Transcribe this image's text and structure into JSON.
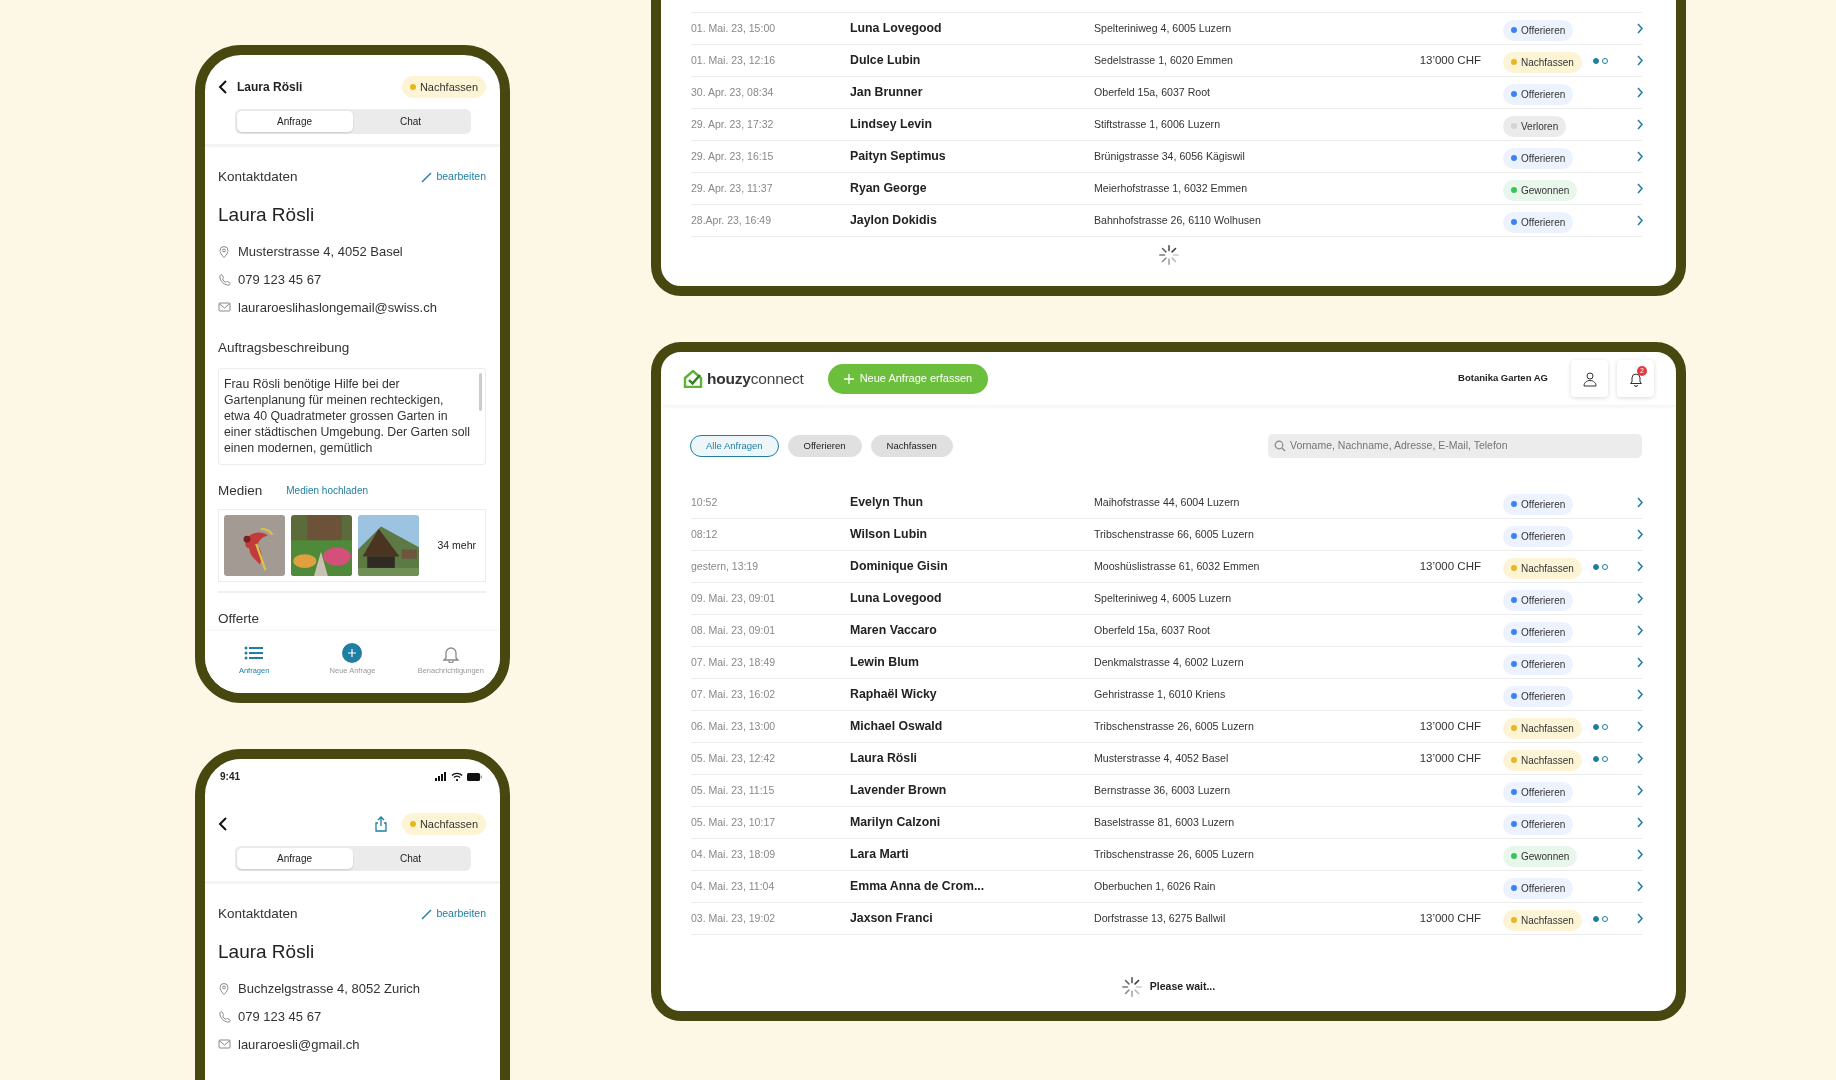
{
  "phone_detail": {
    "title": "Laura Rösli",
    "status": {
      "kind": "followup",
      "label": "Nachfassen",
      "color": "#e6b81e"
    },
    "tabs": [
      {
        "label": "Anfrage",
        "selected": true
      },
      {
        "label": "Chat",
        "selected": false
      }
    ],
    "contact": {
      "heading": "Kontaktdaten",
      "edit_link": "bearbeiten",
      "name": "Laura Rösli",
      "address": "Musterstrasse 4, 4052 Basel",
      "phone": "079 123 45 67",
      "email": "lauraroeslihaslongemail@swiss.ch"
    },
    "description": {
      "heading": "Auftragsbeschreibung",
      "text": "Frau Rösli benötige Hilfe bei der Gartenplanung für meinen rechteckigen, etwa 40 Quadratmeter grossen Garten in einer städtischen Umgebung. Der Garten soll einen modernen, gemütlich"
    },
    "media": {
      "heading": "Medien",
      "upload_link": "Medien hochladen",
      "more": "34 mehr"
    },
    "next_section": "Offerte",
    "bottom_nav": [
      {
        "kind": "list",
        "label": "Anfragen",
        "selected": true
      },
      {
        "kind": "add",
        "label": "Neue Anfrage",
        "selected": false
      },
      {
        "kind": "bell",
        "label": "Benachrichtigungen",
        "selected": false
      }
    ]
  },
  "phone_detail_2": {
    "status_bar": {
      "time": "9:41"
    },
    "status": {
      "kind": "followup",
      "label": "Nachfassen",
      "color": "#e6b81e"
    },
    "tabs": [
      {
        "label": "Anfrage",
        "selected": true
      },
      {
        "label": "Chat",
        "selected": false
      }
    ],
    "contact": {
      "heading": "Kontaktdaten",
      "edit_link": "bearbeiten",
      "name": "Laura Rösli",
      "address": "Buchzelgstrasse 4, 8052 Zurich",
      "phone": "079 123 45 67",
      "email": "lauraroesli@gmail.ch"
    }
  },
  "tablet_list_scrolled": {
    "rows": [
      {
        "time": "01. Mai. 23, 15:00",
        "name": "Luna Lovegood",
        "address": "Spelteriniweg 4, 6005 Luzern",
        "status": {
          "kind": "offer",
          "label": "Offerieren",
          "color": "#3b82f6"
        }
      },
      {
        "time": "01. Mai. 23, 12:16",
        "name": "Dulce Lubin",
        "address": "Sedelstrasse 1, 6020 Emmen",
        "price": "13’000 CHF",
        "status": {
          "kind": "followup",
          "label": "Nachfassen",
          "color": "#e6b81e"
        },
        "steps": [
          {
            "done": true
          },
          {
            "done": false
          }
        ]
      },
      {
        "time": "30. Apr. 23, 08:34",
        "name": "Jan Brunner",
        "address": "Oberfeld 15a, 6037 Root",
        "status": {
          "kind": "offer",
          "label": "Offerieren",
          "color": "#3b82f6"
        }
      },
      {
        "time": "29. Apr. 23, 17:32",
        "name": "Lindsey Levin",
        "address": "Stiftstrasse 1, 6006 Luzern",
        "status": {
          "kind": "lost",
          "label": "Verloren",
          "color": "#d4d4d4"
        }
      },
      {
        "time": "29. Apr. 23, 16:15",
        "name": "Paityn Septimus",
        "address": "Brünigstrasse 34, 6056 Kägiswil",
        "status": {
          "kind": "offer",
          "label": "Offerieren",
          "color": "#3b82f6"
        }
      },
      {
        "time": "29. Apr. 23, 11:37",
        "name": "Ryan George",
        "address": "Meierhofstrasse 1, 6032 Emmen",
        "status": {
          "kind": "won",
          "label": "Gewonnen",
          "color": "#34c759"
        }
      },
      {
        "time": "28.Apr. 23, 16:49",
        "name": "Jaylon Dokidis",
        "address": "Bahnhofstrasse 26, 6110 Wolhusen",
        "status": {
          "kind": "offer",
          "label": "Offerieren",
          "color": "#3b82f6"
        }
      }
    ]
  },
  "tablet_list": {
    "brand": "**houzy**connect",
    "new_button": "Neue Anfrage erfassen",
    "company": "Botanika Garten AG",
    "notification_count": "2",
    "filters": [
      {
        "label": "Alle Anfragen",
        "selected": true
      },
      {
        "label": "Offerieren",
        "selected": false
      },
      {
        "label": "Nachfassen",
        "selected": false
      }
    ],
    "search": {
      "placeholder": "Vorname, Nachname, Adresse, E-Mail, Telefon"
    },
    "rows": [
      {
        "time": "10:52",
        "name": "Evelyn Thun",
        "address": "Maihofstrasse 44, 6004 Luzern",
        "status": {
          "kind": "offer",
          "label": "Offerieren",
          "color": "#3b82f6"
        }
      },
      {
        "time": "08:12",
        "name": "Wilson Lubin",
        "address": "Tribschenstrasse 66, 6005 Luzern",
        "status": {
          "kind": "offer",
          "label": "Offerieren",
          "color": "#3b82f6"
        }
      },
      {
        "time": "gestern, 13:19",
        "name": "Dominique Gisin",
        "address": "Mooshüslistrasse 61, 6032 Emmen",
        "price": "13’000 CHF",
        "status": {
          "kind": "followup",
          "label": "Nachfassen",
          "color": "#e6b81e"
        },
        "steps": [
          {
            "done": true
          },
          {
            "done": false
          }
        ]
      },
      {
        "time": "09. Mai. 23, 09:01",
        "name": "Luna Lovegood",
        "address": "Spelteriniweg 4, 6005 Luzern",
        "status": {
          "kind": "offer",
          "label": "Offerieren",
          "color": "#3b82f6"
        }
      },
      {
        "time": "08. Mai. 23, 09:01",
        "name": "Maren Vaccaro",
        "address": "Oberfeld 15a, 6037 Root",
        "status": {
          "kind": "offer",
          "label": "Offerieren",
          "color": "#3b82f6"
        }
      },
      {
        "time": "07. Mai. 23, 18:49",
        "name": "Lewin Blum",
        "address": "Denkmalstrasse 4, 6002 Luzern",
        "status": {
          "kind": "offer",
          "label": "Offerieren",
          "color": "#3b82f6"
        }
      },
      {
        "time": "07. Mai. 23, 16:02",
        "name": "Raphaël Wicky",
        "address": "Gehristrasse 1, 6010 Kriens",
        "status": {
          "kind": "offer",
          "label": "Offerieren",
          "color": "#3b82f6"
        }
      },
      {
        "time": "06. Mai. 23, 13:00",
        "name": "Michael Oswald",
        "address": "Tribschenstrasse 26, 6005 Luzern",
        "price": "13’000 CHF",
        "status": {
          "kind": "followup",
          "label": "Nachfassen",
          "color": "#e6b81e"
        },
        "steps": [
          {
            "done": true
          },
          {
            "done": false
          }
        ]
      },
      {
        "time": "05. Mai. 23, 12:42",
        "name": "Laura Rösli",
        "address": "Musterstrasse 4, 4052 Basel",
        "price": "13’000 CHF",
        "status": {
          "kind": "followup",
          "label": "Nachfassen",
          "color": "#e6b81e"
        },
        "steps": [
          {
            "done": true
          },
          {
            "done": false
          }
        ]
      },
      {
        "time": "05. Mai. 23, 11:15",
        "name": "Lavender Brown",
        "address": "Bernstrasse 36, 6003 Luzern",
        "status": {
          "kind": "offer",
          "label": "Offerieren",
          "color": "#3b82f6"
        }
      },
      {
        "time": "05. Mai. 23, 10:17",
        "name": "Marilyn Calzoni",
        "address": "Baselstrasse 81, 6003 Luzern",
        "status": {
          "kind": "offer",
          "label": "Offerieren",
          "color": "#3b82f6"
        }
      },
      {
        "time": "04. Mai. 23, 18:09",
        "name": "Lara Marti",
        "address": "Tribschenstrasse 26, 6005 Luzern",
        "status": {
          "kind": "won",
          "label": "Gewonnen",
          "color": "#34c759"
        }
      },
      {
        "time": "04. Mai. 23, 11:04",
        "name": "Emma Anna de Crom...",
        "address": "Oberbuchen 1, 6026 Rain",
        "status": {
          "kind": "offer",
          "label": "Offerieren",
          "color": "#3b82f6"
        }
      },
      {
        "time": "03. Mai. 23, 19:02",
        "name": "Jaxson Franci",
        "address": "Dorfstrasse 13, 6275 Ballwil",
        "price": "13’000 CHF",
        "status": {
          "kind": "followup",
          "label": "Nachfassen",
          "color": "#e6b81e"
        },
        "steps": [
          {
            "done": true
          },
          {
            "done": false
          }
        ]
      }
    ],
    "loading": "Please wait..."
  }
}
